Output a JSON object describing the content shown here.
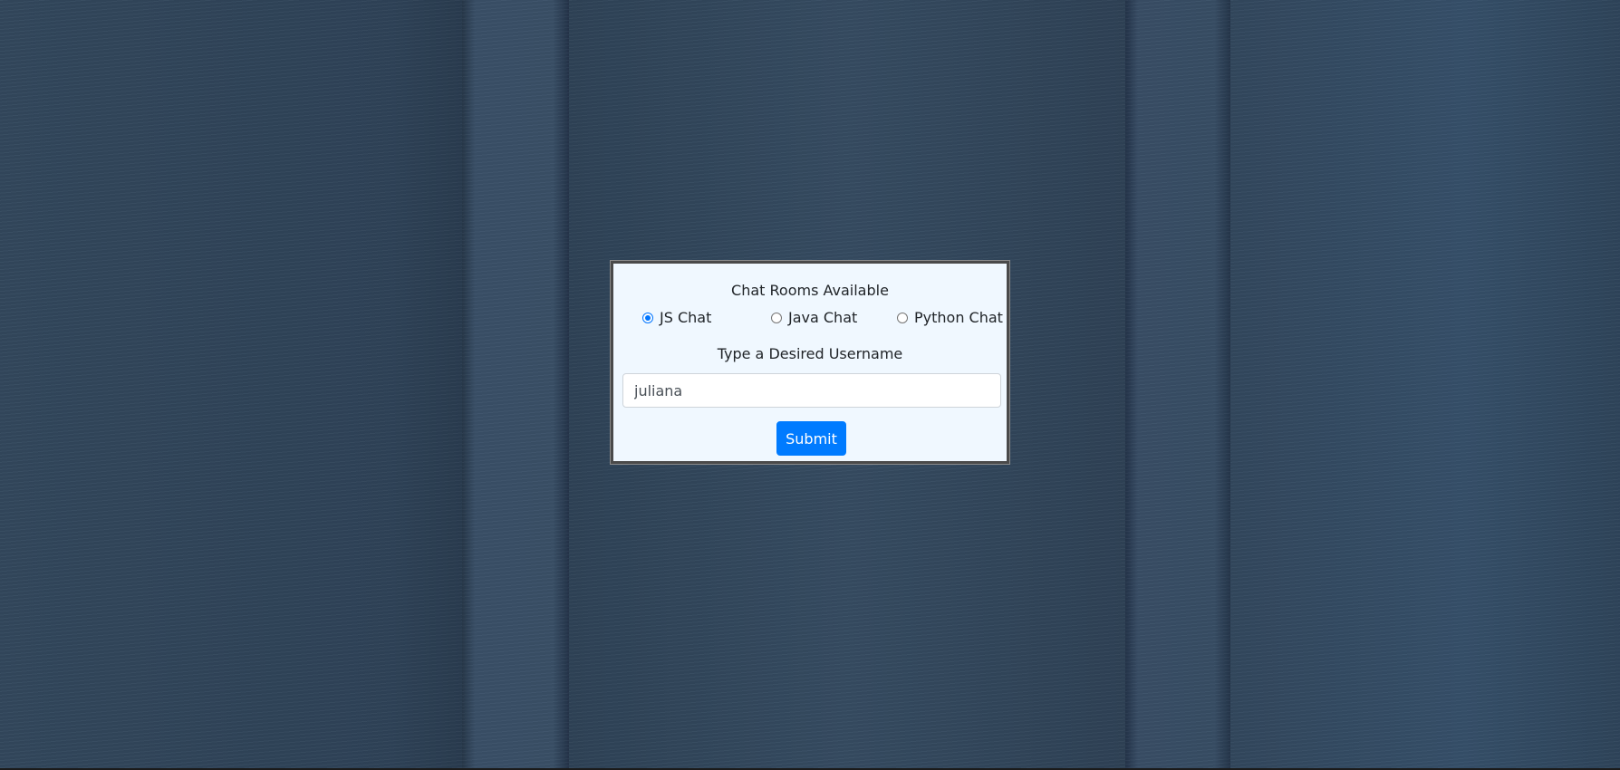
{
  "panel": {
    "title": "Chat Rooms Available",
    "rooms": [
      {
        "label": "JS Chat",
        "checked": true
      },
      {
        "label": "Java Chat",
        "checked": false
      },
      {
        "label": "Python Chat",
        "checked": false
      }
    ],
    "username_label": "Type a Desired Username",
    "username_value": "juliana",
    "submit_label": "Submit"
  },
  "colors": {
    "accent": "#007bff",
    "panel_bg": "#f0f8ff",
    "background": "#34495f"
  }
}
